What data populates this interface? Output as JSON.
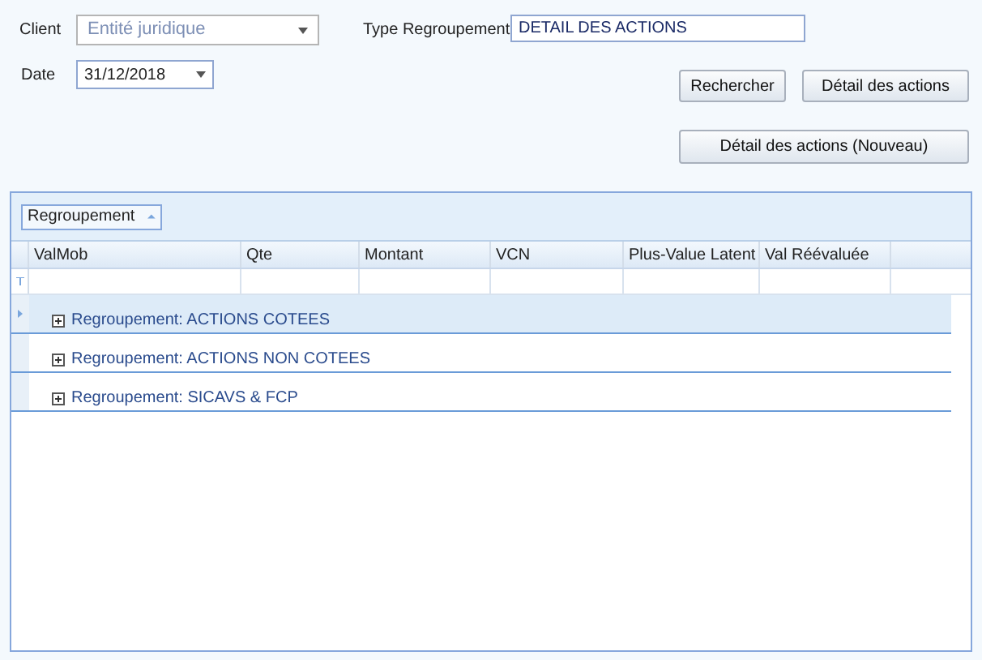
{
  "client": {
    "label": "Client",
    "placeholder": "Entité juridique"
  },
  "type_regroupement": {
    "label": "Type Regroupement",
    "value": "DETAIL DES ACTIONS"
  },
  "date": {
    "label": "Date",
    "value": "31/12/2018"
  },
  "buttons": [
    "Rechercher",
    "Détail des actions",
    "Détail des actions (Nouveau)"
  ],
  "grid": {
    "group_chip": "Regroupement",
    "columns": [
      "ValMob",
      "Qte",
      "Montant",
      "VCN",
      "Plus-Value Latent",
      "Val Réévaluée"
    ],
    "groups": [
      {
        "label": "Regroupement: ACTIONS COTEES",
        "selected": true
      },
      {
        "label": "Regroupement: ACTIONS NON COTEES",
        "selected": false
      },
      {
        "label": "Regroupement: SICAVS & FCP",
        "selected": false
      }
    ]
  }
}
